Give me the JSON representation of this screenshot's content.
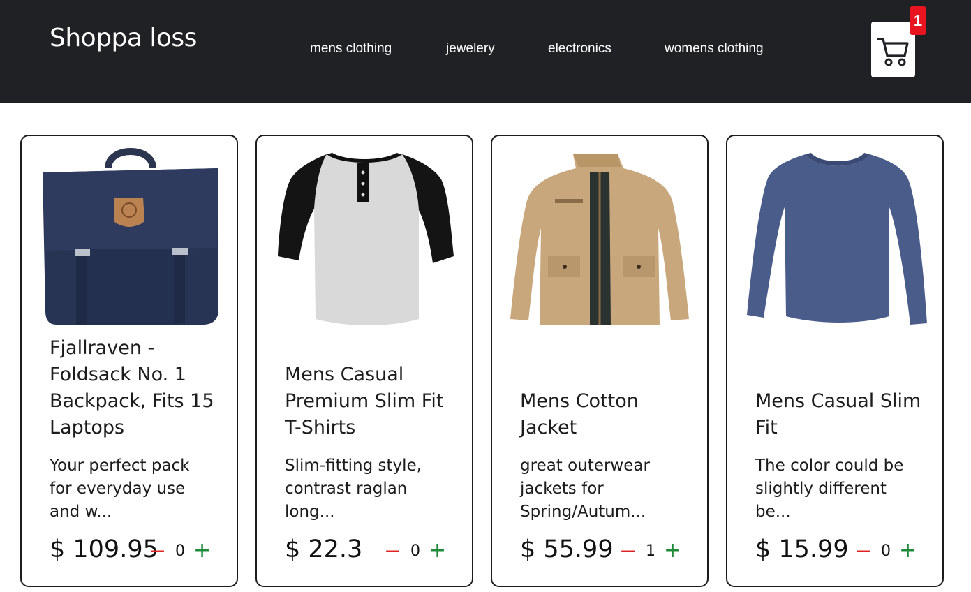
{
  "header": {
    "brand": "Shoppa loss",
    "nav": [
      {
        "label": "mens clothing"
      },
      {
        "label": "jewelery"
      },
      {
        "label": "electronics"
      },
      {
        "label": "womens clothing"
      }
    ],
    "cart": {
      "icon": "cart-icon",
      "count": "1"
    }
  },
  "products": [
    {
      "title": "Fjallraven - Foldsack No. 1 Backpack, Fits 15 Laptops",
      "description": "Your perfect pack for everyday use and w...",
      "price": "$ 109.95",
      "qty": "0",
      "minus": "−",
      "plus": "+",
      "image": "navy-backpack"
    },
    {
      "title": "Mens Casual Premium Slim Fit T-Shirts",
      "description": "Slim-fitting style, contrast raglan long...",
      "price": "$ 22.3",
      "qty": "0",
      "minus": "−",
      "plus": "+",
      "image": "raglan-henley-shirt"
    },
    {
      "title": "Mens Cotton Jacket",
      "description": "great outerwear jackets for Spring/Autum...",
      "price": "$ 55.99",
      "qty": "1",
      "minus": "−",
      "plus": "+",
      "image": "khaki-cotton-jacket"
    },
    {
      "title": "Mens Casual Slim Fit",
      "description": "The color could be slightly different be...",
      "price": "$ 15.99",
      "qty": "0",
      "minus": "−",
      "plus": "+",
      "image": "blue-long-sleeve-tee"
    }
  ],
  "colors": {
    "navbar": "#1f2124",
    "badge": "#e8141f",
    "minus": "#e02424",
    "plus": "#1e8a3a"
  }
}
